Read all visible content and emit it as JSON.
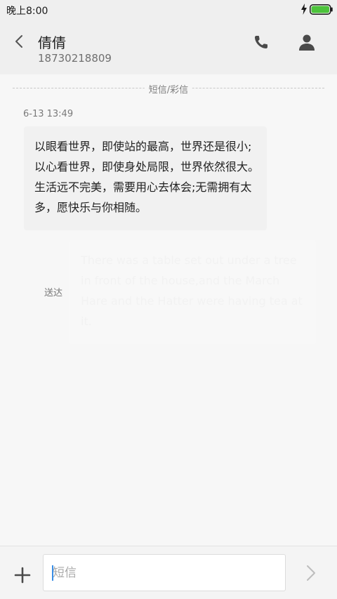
{
  "status_bar": {
    "time": "晚上8:00",
    "bolt_icon": "charging-bolt-icon",
    "battery_icon": "battery-icon",
    "battery_color": "#4cc33b"
  },
  "header": {
    "back_icon": "back-arrow-icon",
    "contact_name": "倩倩",
    "contact_number": "18730218809",
    "phone_icon": "phone-icon",
    "contact_icon": "person-icon"
  },
  "conversation": {
    "channel_divider": "短信/彩信",
    "timestamp": "6-13 13:49",
    "incoming_message": "以眼看世界，即使站的最高，世界还是很小;以心看世界，即使身处局限，世界依然很大。生活远不完美，需要用心去体会;无需拥有太多，愿快乐与你相随。",
    "outgoing_status": "送达",
    "outgoing_message": "There was a table set out under a tree in front of the house,and the March Hare and the Hatter were having tea at it."
  },
  "composer": {
    "add_icon": "plus-icon",
    "input_placeholder": "短信",
    "input_value": "",
    "send_icon": "send-chevron-icon"
  }
}
